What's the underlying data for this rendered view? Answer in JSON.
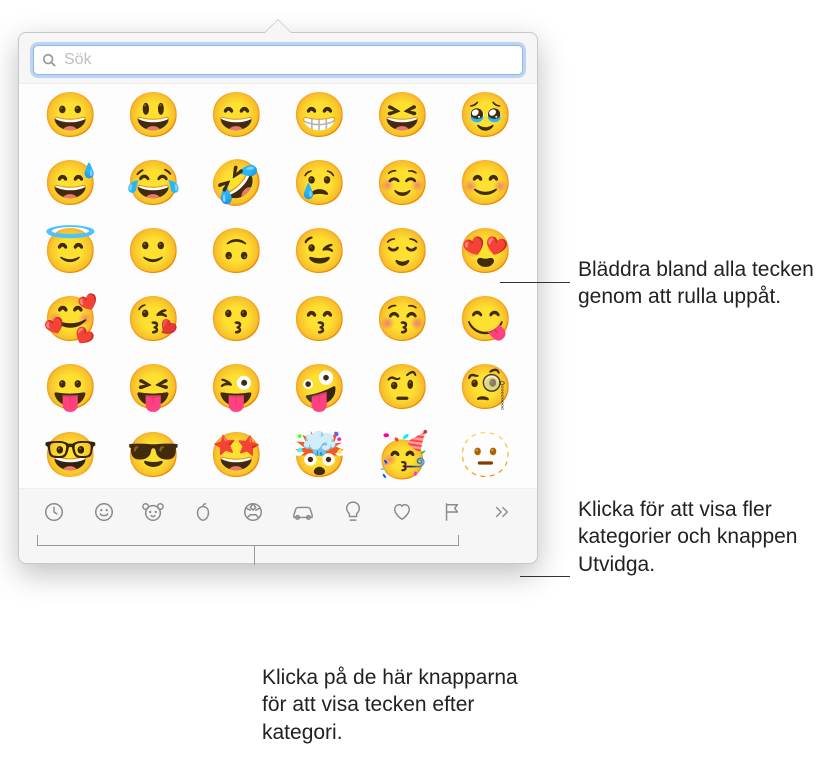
{
  "search": {
    "placeholder": "Sök",
    "value": ""
  },
  "emojis": [
    "😀",
    "😃",
    "😄",
    "😁",
    "😆",
    "🥹",
    "😅",
    "😂",
    "🤣",
    "😢",
    "☺️",
    "😊",
    "😇",
    "🙂",
    "🙃",
    "😉",
    "😌",
    "😍",
    "🥰",
    "😘",
    "😗",
    "😙",
    "😚",
    "😋",
    "😛",
    "😝",
    "😜",
    "🤪",
    "🤨",
    "🧐",
    "🤓",
    "😎",
    "🤩",
    "🤯",
    "🥳",
    "🫥"
  ],
  "categories": [
    {
      "name": "recent",
      "icon": "clock"
    },
    {
      "name": "smileys",
      "icon": "face"
    },
    {
      "name": "animals",
      "icon": "animal"
    },
    {
      "name": "food",
      "icon": "apple"
    },
    {
      "name": "activity",
      "icon": "soccer"
    },
    {
      "name": "travel",
      "icon": "car"
    },
    {
      "name": "objects",
      "icon": "bulb"
    },
    {
      "name": "symbols",
      "icon": "heart"
    },
    {
      "name": "flags",
      "icon": "flag"
    },
    {
      "name": "more",
      "icon": "chevron"
    }
  ],
  "callouts": {
    "scroll": "Bläddra bland alla tecken genom att rulla uppåt.",
    "more": "Klicka för att visa fler kategorier och knappen Utvidga.",
    "categories": "Klicka på de här knapparna för att visa tecken efter kategori."
  }
}
